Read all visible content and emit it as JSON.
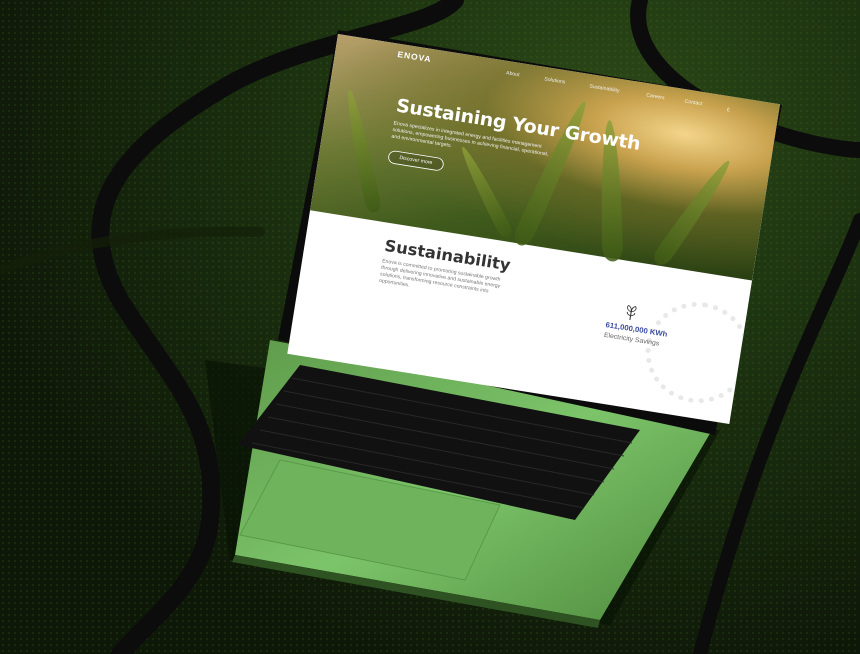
{
  "site": {
    "logo": "ENOVA",
    "nav": [
      "About",
      "Solutions",
      "Sustainability",
      "Careers",
      "Contact"
    ],
    "lang": "ع"
  },
  "hero": {
    "title": "Sustaining Your Growth",
    "text": "Enova specializes in integrated energy and facilities management solutions, empowering businesses in achieving financial, operational, and environmental targets.",
    "button": "Discover more"
  },
  "sustainability": {
    "title": "Sustainability",
    "text": "Enova is committed to promoting sustainable growth through delivering innovative and sustainable energy solutions, transforming resource constraints into opportunities.",
    "stat_value": "611,000,000 KWh",
    "stat_label": "Electricity Savings",
    "icon": "plant-icon"
  },
  "colors": {
    "background": "#1c3210",
    "keyboard_base": "#7cc46a",
    "stat_blue": "#3e4fa0"
  }
}
